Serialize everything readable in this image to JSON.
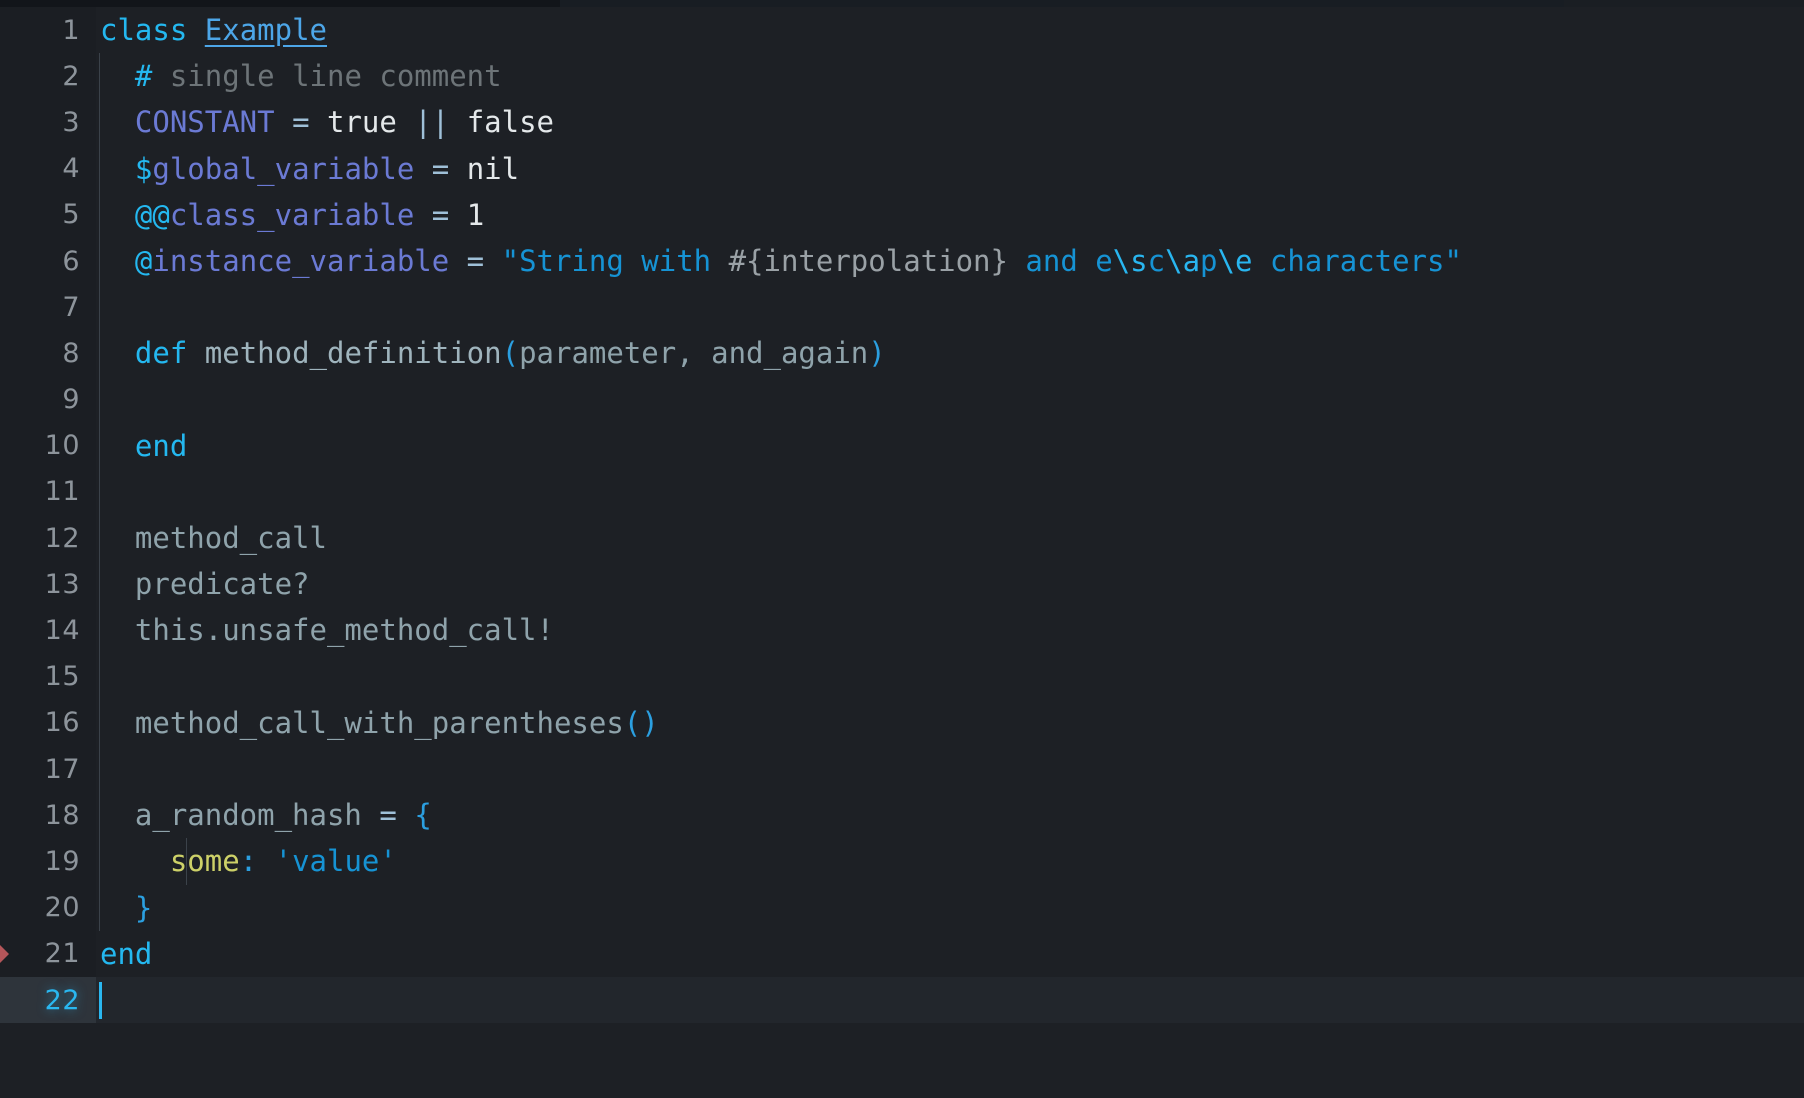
{
  "editor": {
    "language": "ruby",
    "theme_name": "dark",
    "background": "#1d2025",
    "gutter_background": "#1b1e23",
    "active_line_background": "#22262c",
    "active_gutter_background": "#2e343b",
    "active_line_number_color": "#2ab7f0",
    "line_number_color": "#8d949b",
    "caret_color": "#2ab7f0",
    "marker_color": "#b4565a",
    "indent_guide_color": "#3b424a",
    "cursor_line": 22,
    "total_lines": 22
  },
  "palette": {
    "keyword": "#24b8f0",
    "class_name": "#4da6e8",
    "comment": "#6d7478",
    "comment_hash": "#24b8f0",
    "constant": "#6b7ad4",
    "variable": "#6b7ad4",
    "sigil": "#24b8f0",
    "operator": "#9fc0d8",
    "plain": "#e4e8ea",
    "identifier": "#8fa3ab",
    "method_name": "#9fb4bd",
    "parenthesis": "#2b9fe0",
    "string": "#1693d4",
    "escape": "#29b6f0",
    "interpolation": "#9aa1a6",
    "symbol": "#cdd168",
    "brace": "#2b9fe0"
  },
  "lines": [
    {
      "number": "1",
      "marker": false,
      "active": false,
      "indent_guides": [],
      "tokens": [
        {
          "t": "class",
          "c": "keyword"
        },
        {
          "t": " ",
          "c": "plain"
        },
        {
          "t": "Example",
          "c": "class"
        }
      ]
    },
    {
      "number": "2",
      "marker": false,
      "active": false,
      "indent_guides": [
        "lvl1"
      ],
      "tokens": [
        {
          "t": "  ",
          "c": "plain"
        },
        {
          "t": "#",
          "c": "comment-h"
        },
        {
          "t": " single line comment",
          "c": "comment"
        }
      ]
    },
    {
      "number": "3",
      "marker": false,
      "active": false,
      "indent_guides": [
        "lvl1"
      ],
      "tokens": [
        {
          "t": "  ",
          "c": "plain"
        },
        {
          "t": "CONSTANT",
          "c": "const"
        },
        {
          "t": " ",
          "c": "plain"
        },
        {
          "t": "=",
          "c": "op"
        },
        {
          "t": " ",
          "c": "plain"
        },
        {
          "t": "true",
          "c": "plain"
        },
        {
          "t": " ",
          "c": "plain"
        },
        {
          "t": "||",
          "c": "op"
        },
        {
          "t": " ",
          "c": "plain"
        },
        {
          "t": "false",
          "c": "plain"
        }
      ]
    },
    {
      "number": "4",
      "marker": false,
      "active": false,
      "indent_guides": [
        "lvl1"
      ],
      "tokens": [
        {
          "t": "  ",
          "c": "plain"
        },
        {
          "t": "$",
          "c": "sigil"
        },
        {
          "t": "global_variable",
          "c": "var"
        },
        {
          "t": " ",
          "c": "plain"
        },
        {
          "t": "=",
          "c": "op"
        },
        {
          "t": " ",
          "c": "plain"
        },
        {
          "t": "nil",
          "c": "plain"
        }
      ]
    },
    {
      "number": "5",
      "marker": false,
      "active": false,
      "indent_guides": [
        "lvl1"
      ],
      "tokens": [
        {
          "t": "  ",
          "c": "plain"
        },
        {
          "t": "@@",
          "c": "sigil"
        },
        {
          "t": "class_variable",
          "c": "var"
        },
        {
          "t": " ",
          "c": "plain"
        },
        {
          "t": "=",
          "c": "op"
        },
        {
          "t": " ",
          "c": "plain"
        },
        {
          "t": "1",
          "c": "number"
        }
      ]
    },
    {
      "number": "6",
      "marker": false,
      "active": false,
      "indent_guides": [
        "lvl1"
      ],
      "tokens": [
        {
          "t": "  ",
          "c": "plain"
        },
        {
          "t": "@",
          "c": "sigil"
        },
        {
          "t": "instance_variable",
          "c": "var"
        },
        {
          "t": " ",
          "c": "plain"
        },
        {
          "t": "=",
          "c": "op"
        },
        {
          "t": " ",
          "c": "plain"
        },
        {
          "t": "\"String with ",
          "c": "string"
        },
        {
          "t": "#{interpolation}",
          "c": "interp"
        },
        {
          "t": " and e",
          "c": "string"
        },
        {
          "t": "\\s",
          "c": "escape"
        },
        {
          "t": "c",
          "c": "string"
        },
        {
          "t": "\\a",
          "c": "escape"
        },
        {
          "t": "p",
          "c": "string"
        },
        {
          "t": "\\e",
          "c": "escape"
        },
        {
          "t": " characters\"",
          "c": "string"
        }
      ]
    },
    {
      "number": "7",
      "marker": false,
      "active": false,
      "indent_guides": [
        "lvl1"
      ],
      "tokens": []
    },
    {
      "number": "8",
      "marker": false,
      "active": false,
      "indent_guides": [
        "lvl1"
      ],
      "tokens": [
        {
          "t": "  ",
          "c": "plain"
        },
        {
          "t": "def",
          "c": "keyword"
        },
        {
          "t": " ",
          "c": "plain"
        },
        {
          "t": "method_definition",
          "c": "method"
        },
        {
          "t": "(",
          "c": "paren"
        },
        {
          "t": "parameter, and_again",
          "c": "ident"
        },
        {
          "t": ")",
          "c": "paren"
        }
      ]
    },
    {
      "number": "9",
      "marker": false,
      "active": false,
      "indent_guides": [
        "lvl1"
      ],
      "tokens": []
    },
    {
      "number": "10",
      "marker": false,
      "active": false,
      "indent_guides": [
        "lvl1"
      ],
      "tokens": [
        {
          "t": "  ",
          "c": "plain"
        },
        {
          "t": "end",
          "c": "keyword"
        }
      ]
    },
    {
      "number": "11",
      "marker": false,
      "active": false,
      "indent_guides": [
        "lvl1"
      ],
      "tokens": []
    },
    {
      "number": "12",
      "marker": false,
      "active": false,
      "indent_guides": [
        "lvl1"
      ],
      "tokens": [
        {
          "t": "  ",
          "c": "plain"
        },
        {
          "t": "method_call",
          "c": "ident"
        }
      ]
    },
    {
      "number": "13",
      "marker": false,
      "active": false,
      "indent_guides": [
        "lvl1"
      ],
      "tokens": [
        {
          "t": "  ",
          "c": "plain"
        },
        {
          "t": "predicate?",
          "c": "ident"
        }
      ]
    },
    {
      "number": "14",
      "marker": false,
      "active": false,
      "indent_guides": [
        "lvl1"
      ],
      "tokens": [
        {
          "t": "  ",
          "c": "plain"
        },
        {
          "t": "this.unsafe_method_call!",
          "c": "ident"
        }
      ]
    },
    {
      "number": "15",
      "marker": false,
      "active": false,
      "indent_guides": [
        "lvl1"
      ],
      "tokens": []
    },
    {
      "number": "16",
      "marker": false,
      "active": false,
      "indent_guides": [
        "lvl1"
      ],
      "tokens": [
        {
          "t": "  ",
          "c": "plain"
        },
        {
          "t": "method_call_with_parentheses",
          "c": "ident"
        },
        {
          "t": "()",
          "c": "paren"
        }
      ]
    },
    {
      "number": "17",
      "marker": false,
      "active": false,
      "indent_guides": [
        "lvl1"
      ],
      "tokens": []
    },
    {
      "number": "18",
      "marker": false,
      "active": false,
      "indent_guides": [
        "lvl1"
      ],
      "tokens": [
        {
          "t": "  ",
          "c": "plain"
        },
        {
          "t": "a_random_hash",
          "c": "ident"
        },
        {
          "t": " ",
          "c": "plain"
        },
        {
          "t": "=",
          "c": "op"
        },
        {
          "t": " ",
          "c": "plain"
        },
        {
          "t": "{",
          "c": "brace"
        }
      ]
    },
    {
      "number": "19",
      "marker": false,
      "active": false,
      "indent_guides": [
        "lvl1",
        "lvl2"
      ],
      "tokens": [
        {
          "t": "    ",
          "c": "plain"
        },
        {
          "t": "some",
          "c": "symbol"
        },
        {
          "t": ":",
          "c": "colon"
        },
        {
          "t": " ",
          "c": "plain"
        },
        {
          "t": "'value'",
          "c": "strq"
        }
      ]
    },
    {
      "number": "20",
      "marker": false,
      "active": false,
      "indent_guides": [
        "lvl1"
      ],
      "tokens": [
        {
          "t": "  ",
          "c": "plain"
        },
        {
          "t": "}",
          "c": "brace"
        }
      ]
    },
    {
      "number": "21",
      "marker": true,
      "active": false,
      "indent_guides": [],
      "tokens": [
        {
          "t": "end",
          "c": "keyword"
        }
      ]
    },
    {
      "number": "22",
      "marker": false,
      "active": true,
      "indent_guides": [],
      "tokens": []
    }
  ]
}
